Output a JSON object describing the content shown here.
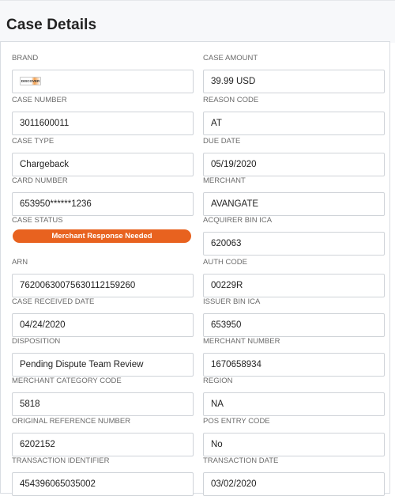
{
  "page": {
    "title": "Case Details"
  },
  "fields": {
    "brand": {
      "label": "BRAND",
      "logo_text": "DISCOVER",
      "icon": "discover-card-logo"
    },
    "case_amount": {
      "label": "CASE AMOUNT",
      "value": "39.99 USD"
    },
    "case_number": {
      "label": "CASE NUMBER",
      "value": "3011600011"
    },
    "reason_code": {
      "label": "REASON CODE",
      "value": "AT"
    },
    "case_type": {
      "label": "CASE TYPE",
      "value": "Chargeback"
    },
    "due_date": {
      "label": "DUE DATE",
      "value": "05/19/2020"
    },
    "card_number": {
      "label": "CARD NUMBER",
      "value": "653950******1236"
    },
    "merchant": {
      "label": "MERCHANT",
      "value": "AVANGATE"
    },
    "case_status": {
      "label": "CASE STATUS",
      "value": "Merchant Response Needed",
      "color": "#e8621f"
    },
    "acquirer_bin_ica": {
      "label": "ACQUIRER BIN ICA",
      "value": "620063"
    },
    "arn": {
      "label": "ARN",
      "value": "76200630075630112159260"
    },
    "auth_code": {
      "label": "AUTH CODE",
      "value": "00229R"
    },
    "case_received_date": {
      "label": "CASE RECEIVED DATE",
      "value": "04/24/2020"
    },
    "issuer_bin_ica": {
      "label": "ISSUER BIN ICA",
      "value": "653950"
    },
    "disposition": {
      "label": "DISPOSITION",
      "value": "Pending Dispute Team Review"
    },
    "merchant_number": {
      "label": "MERCHANT NUMBER",
      "value": "1670658934"
    },
    "merchant_category_code": {
      "label": "MERCHANT CATEGORY CODE",
      "value": "5818"
    },
    "region": {
      "label": "REGION",
      "value": "NA"
    },
    "original_reference_number": {
      "label": "ORIGINAL REFERENCE NUMBER",
      "value": "6202152"
    },
    "pos_entry_code": {
      "label": "POS ENTRY CODE",
      "value": "No"
    },
    "transaction_identifier": {
      "label": "TRANSACTION IDENTIFIER",
      "value": "454396065035002"
    },
    "transaction_date": {
      "label": "TRANSACTION DATE",
      "value": "03/02/2020"
    }
  }
}
